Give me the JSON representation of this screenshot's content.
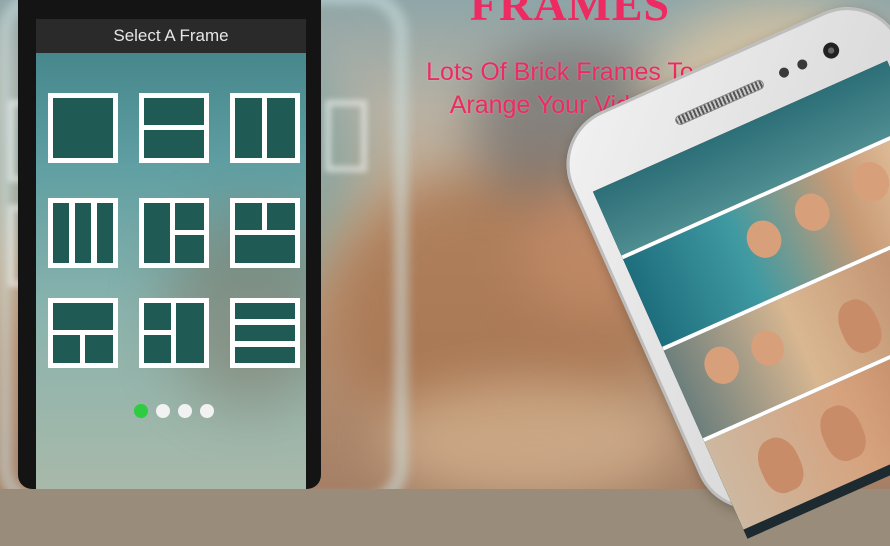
{
  "headline": {
    "title": "FRAMES",
    "subtitle_line1": "Lots Of Brick Frames To",
    "subtitle_line2": "Arange Your Videos"
  },
  "frame_picker": {
    "header": "Select A Frame",
    "frames": [
      {
        "icon": "single-frame-icon"
      },
      {
        "icon": "two-rows-frame-icon"
      },
      {
        "icon": "two-columns-frame-icon"
      },
      {
        "icon": "three-columns-frame-icon"
      },
      {
        "icon": "column-plus-two-rows-frame-icon"
      },
      {
        "icon": "two-top-one-bottom-frame-icon"
      },
      {
        "icon": "one-top-two-bottom-frame-icon"
      },
      {
        "icon": "column-split-frame-icon"
      },
      {
        "icon": "three-rows-frame-icon"
      }
    ],
    "pagination": {
      "pages": 4,
      "current": 1
    }
  },
  "colors": {
    "accent": "#ee2a62",
    "frame_fill": "#1f5a55",
    "active_dot": "#2ecc40",
    "inactive_dot": "#f2f2f2"
  }
}
